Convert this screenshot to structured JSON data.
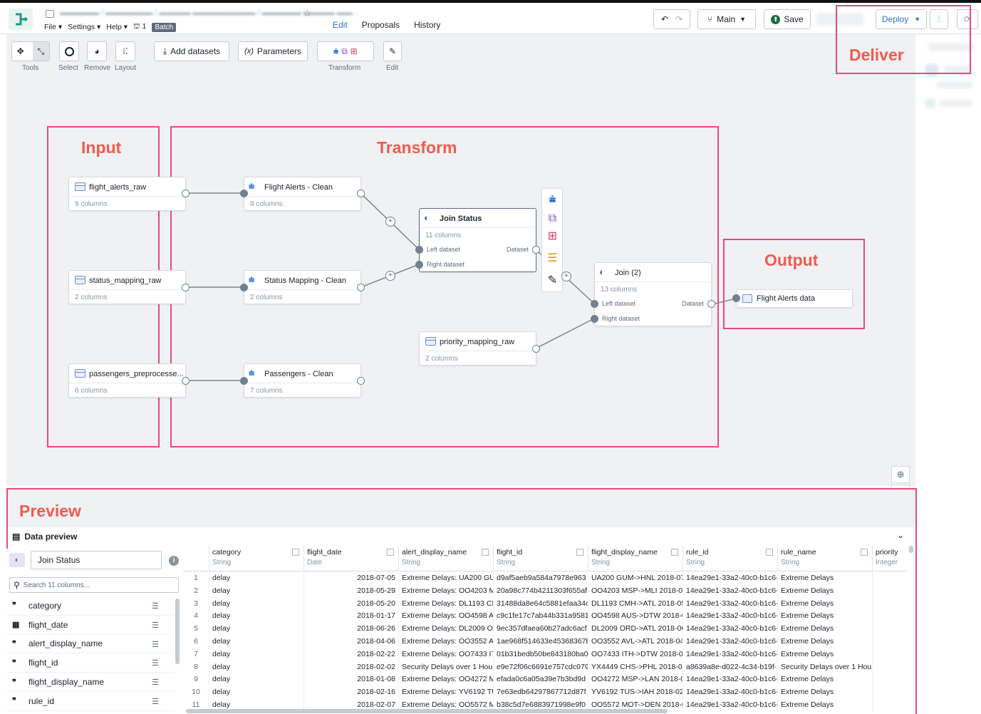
{
  "app": {
    "menus": {
      "file": "File ▾",
      "settings": "Settings ▾",
      "help": "Help ▾",
      "branch_count": "1",
      "batch": "Batch"
    },
    "tabs": [
      "Edit",
      "Proposals",
      "History"
    ],
    "branch": "Main",
    "save": "Save",
    "deploy": "Deploy"
  },
  "toolbar": {
    "tools_label": "Tools",
    "select_label": "Select",
    "remove_label": "Remove",
    "layout_label": "Layout",
    "add_datasets": "Add datasets",
    "parameters": "Parameters",
    "transform_label": "Transform",
    "edit_label": "Edit"
  },
  "regions": {
    "input": "Input",
    "transform": "Transform",
    "output": "Output",
    "deliver": "Deliver",
    "preview": "Preview"
  },
  "nodes": {
    "flight_alerts_raw": {
      "title": "flight_alerts_raw",
      "sub": "9 columns"
    },
    "status_mapping_raw": {
      "title": "status_mapping_raw",
      "sub": "2 columns"
    },
    "passengers_pre": {
      "title": "passengers_preprocesse...",
      "sub": "6 columns"
    },
    "flight_alerts_clean": {
      "title": "Flight Alerts - Clean",
      "sub": "9 columns"
    },
    "status_mapping_clean": {
      "title": "Status Mapping - Clean",
      "sub": "2 columns"
    },
    "passengers_clean": {
      "title": "Passengers - Clean",
      "sub": "7 columns"
    },
    "join_status": {
      "title": "Join Status",
      "sub": "11 columns",
      "left": "Left dataset",
      "right": "Right dataset",
      "out": "Dataset"
    },
    "priority_mapping_raw": {
      "title": "priority_mapping_raw",
      "sub": "2 columns"
    },
    "join2": {
      "title": "Join (2)",
      "sub": "13 columns",
      "left": "Left dataset",
      "right": "Right dataset",
      "out": "Dataset"
    },
    "flight_alerts_data": {
      "title": "Flight Alerts data"
    }
  },
  "preview": {
    "title": "Data preview",
    "selected": "Join Status",
    "search_placeholder": "Search 11 columns...",
    "fields": [
      {
        "name": "category",
        "icon": "quote"
      },
      {
        "name": "flight_date",
        "icon": "calendar"
      },
      {
        "name": "alert_display_name",
        "icon": "quote"
      },
      {
        "name": "flight_id",
        "icon": "quote"
      },
      {
        "name": "flight_display_name",
        "icon": "quote"
      },
      {
        "name": "rule_id",
        "icon": "quote"
      }
    ],
    "columns": [
      {
        "name": "category",
        "type": "String"
      },
      {
        "name": "flight_date",
        "type": "Date"
      },
      {
        "name": "alert_display_name",
        "type": "String"
      },
      {
        "name": "flight_id",
        "type": "String"
      },
      {
        "name": "flight_display_name",
        "type": "String"
      },
      {
        "name": "rule_id",
        "type": "String"
      },
      {
        "name": "rule_name",
        "type": "String"
      },
      {
        "name": "priority",
        "type": "Integer"
      }
    ],
    "rows": [
      [
        "1",
        "delay",
        "2018-07-05",
        "Extreme Delays: UA200 GUI",
        "d9af5aeb9a584a7978e963",
        "UA200 GUM->HNL 2018-07-",
        "14ea29e1-33a2-40c0-b1c6-",
        "Extreme Delays",
        ""
      ],
      [
        "2",
        "delay",
        "2018-05-29",
        "Extreme Delays: OO4203 M",
        "20a98c774b4211303f655af",
        "OO4203 MSP->MLI 2018-05",
        "14ea29e1-33a2-40c0-b1c6-",
        "Extreme Delays",
        ""
      ],
      [
        "3",
        "delay",
        "2018-05-20",
        "Extreme Delays: DL1193 CM",
        "31488da8e64c5881efaa34c",
        "DL1193 CMH->ATL 2018-05",
        "14ea29e1-33a2-40c0-b1c6-",
        "Extreme Delays",
        ""
      ],
      [
        "4",
        "delay",
        "2018-01-17",
        "Extreme Delays: OO4598 AU",
        "c9c1fe17c7ab44b331a9581",
        "OO4598 AUS->DTW 2018-0",
        "14ea29e1-33a2-40c0-b1c6-",
        "Extreme Delays",
        ""
      ],
      [
        "5",
        "delay",
        "2018-06-26",
        "Extreme Delays: DL2009 OR",
        "9ec357dfaea60b27adc6acf",
        "DL2009 ORD->ATL 2018-06-",
        "14ea29e1-33a2-40c0-b1c6-",
        "Extreme Delays",
        ""
      ],
      [
        "6",
        "delay",
        "2018-04-06",
        "Extreme Delays: OO3552 AV",
        "1ae968f514633e45368367b",
        "OO3552 AVL->ATL 2018-04-",
        "14ea29e1-33a2-40c0-b1c6-",
        "Extreme Delays",
        ""
      ],
      [
        "7",
        "delay",
        "2018-02-22",
        "Extreme Delays: OO7433 IT",
        "01b31bedb50be843180ba0",
        "OO7433 ITH->DTW 2018-02",
        "14ea29e1-33a2-40c0-b1c6-",
        "Extreme Delays",
        ""
      ],
      [
        "8",
        "delay",
        "2018-02-02",
        "Security Delays over 1 Hou",
        "e9e72f06c6691e757cdc079",
        "YX4449 CHS->PHL 2018-02-",
        "a8639a8e-d022-4c34-b19f-",
        "Security Delays over 1 Hou",
        ""
      ],
      [
        "9",
        "delay",
        "2018-01-08",
        "Extreme Delays: OO4272 M",
        "efada0c6a05a39e7b3bd9d",
        "OO4272 MSP->LAN 2018-01",
        "14ea29e1-33a2-40c0-b1c6-",
        "Extreme Delays",
        ""
      ],
      [
        "10",
        "delay",
        "2018-02-16",
        "Extreme Delays: YV6192 TU",
        "7e63edb64297867712d87f",
        "YV6192 TUS->IAH 2018-02-",
        "14ea29e1-33a2-40c0-b1c6-",
        "Extreme Delays",
        ""
      ],
      [
        "11",
        "delay",
        "2018-02-07",
        "Extreme Delays: OO5572 M",
        "b38c5d7e6883971998e9f0",
        "OO5572 MOT->DEN 2018-0",
        "14ea29e1-33a2-40c0-b1c6-",
        "Extreme Delays",
        ""
      ]
    ]
  },
  "colors": {
    "accent": "#2d72d2",
    "region": "#e8497f",
    "region_label": "#f25a50",
    "save_green": "#1c6e42"
  }
}
